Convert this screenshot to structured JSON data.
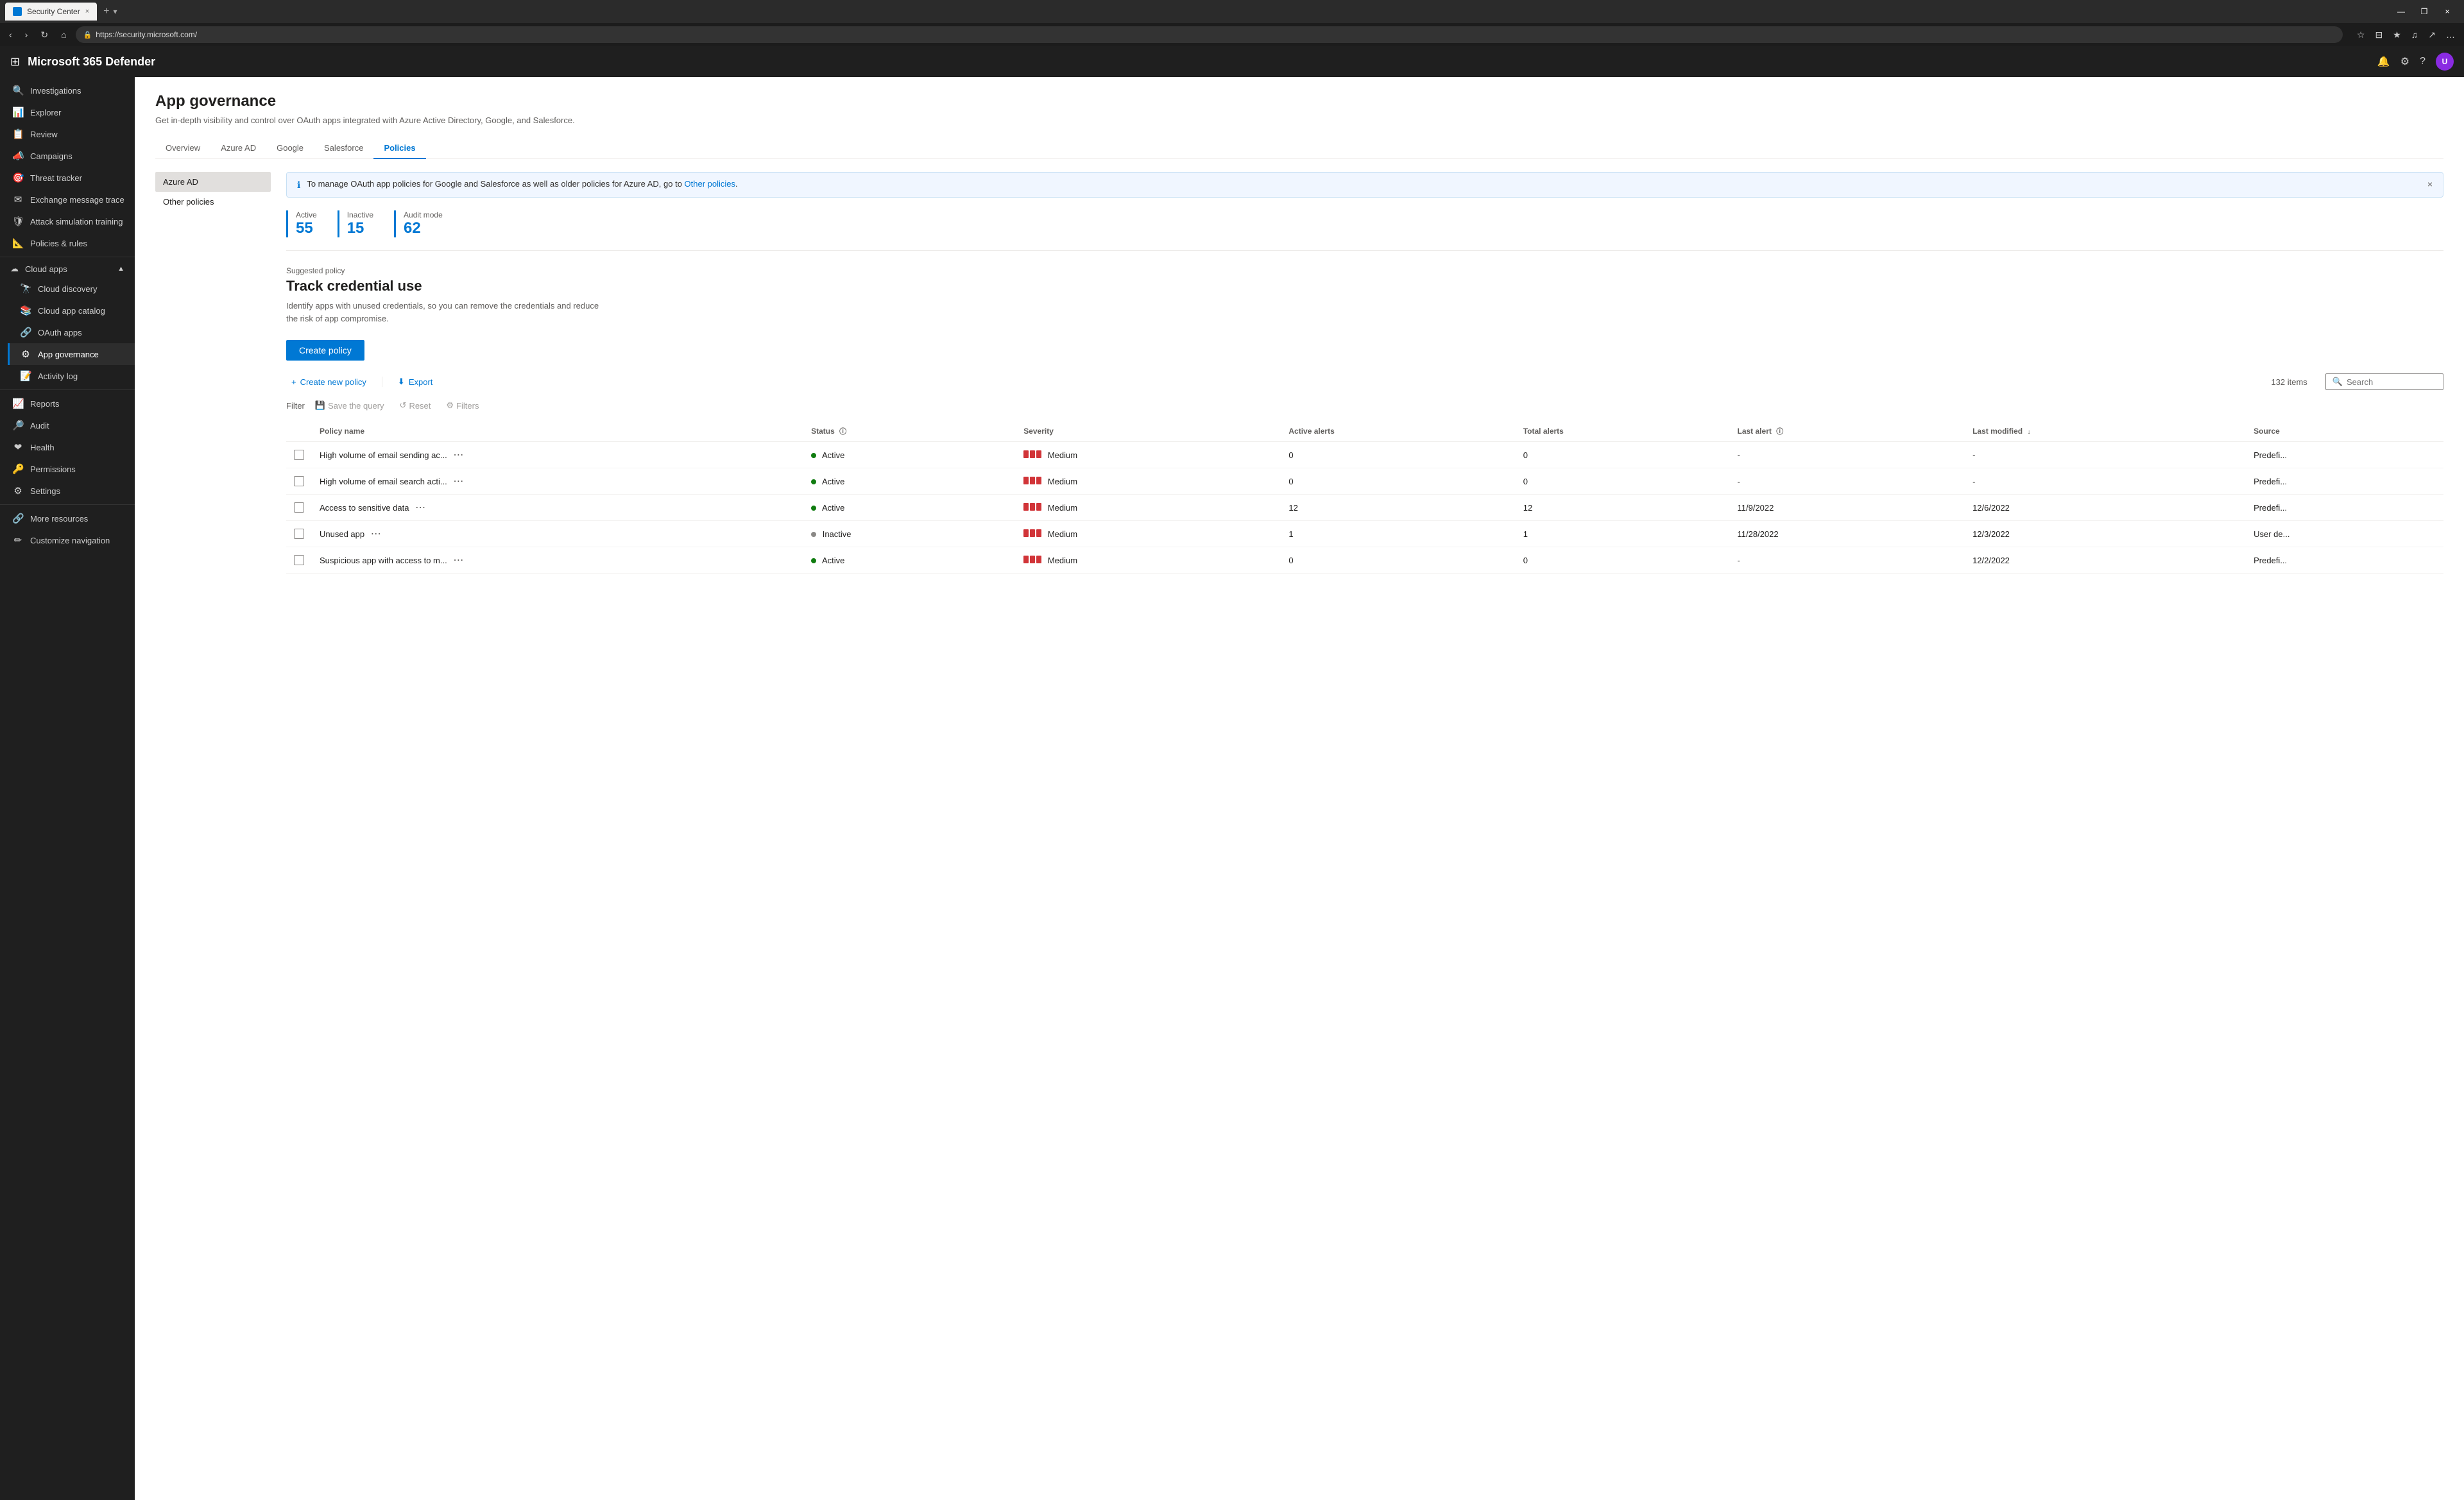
{
  "browser": {
    "tab_title": "Security Center",
    "url": "https://security.microsoft.com/",
    "tab_close": "×",
    "new_tab": "+",
    "win_minimize": "—",
    "win_restore": "❐",
    "win_close": "×"
  },
  "topbar": {
    "app_title": "Microsoft 365 Defender",
    "grid_icon": "⊞"
  },
  "sidebar": {
    "items": [
      {
        "id": "investigations",
        "label": "Investigations",
        "icon": "🔍"
      },
      {
        "id": "explorer",
        "label": "Explorer",
        "icon": "📊"
      },
      {
        "id": "review",
        "label": "Review",
        "icon": "📋"
      },
      {
        "id": "campaigns",
        "label": "Campaigns",
        "icon": "📣"
      },
      {
        "id": "threat-tracker",
        "label": "Threat tracker",
        "icon": "🎯"
      },
      {
        "id": "exchange",
        "label": "Exchange message trace",
        "icon": "✉"
      },
      {
        "id": "attack-sim",
        "label": "Attack simulation training",
        "icon": "🛡"
      },
      {
        "id": "policies",
        "label": "Policies & rules",
        "icon": "📐"
      },
      {
        "id": "cloud-apps-group",
        "label": "Cloud apps",
        "icon": "☁",
        "expandable": true,
        "expanded": true
      },
      {
        "id": "cloud-discovery",
        "label": "Cloud discovery",
        "icon": "🔭",
        "sub": true
      },
      {
        "id": "cloud-catalog",
        "label": "Cloud app catalog",
        "icon": "📚",
        "sub": true
      },
      {
        "id": "oauth-apps",
        "label": "OAuth apps",
        "icon": "🔗",
        "sub": true
      },
      {
        "id": "app-governance",
        "label": "App governance",
        "icon": "⚙",
        "sub": true,
        "active": true
      },
      {
        "id": "activity-log",
        "label": "Activity log",
        "icon": "📝",
        "sub": true
      },
      {
        "id": "reports",
        "label": "Reports",
        "icon": "📈"
      },
      {
        "id": "audit",
        "label": "Audit",
        "icon": "🔎"
      },
      {
        "id": "health",
        "label": "Health",
        "icon": "❤"
      },
      {
        "id": "permissions",
        "label": "Permissions",
        "icon": "🔑"
      },
      {
        "id": "settings",
        "label": "Settings",
        "icon": "⚙"
      },
      {
        "id": "more-resources",
        "label": "More resources",
        "icon": "🔗"
      },
      {
        "id": "customize-nav",
        "label": "Customize navigation",
        "icon": "✏"
      }
    ]
  },
  "page": {
    "title": "App governance",
    "description": "Get in-depth visibility and control over OAuth apps integrated with Azure Active Directory, Google, and Salesforce.",
    "tabs": [
      {
        "id": "overview",
        "label": "Overview",
        "active": false
      },
      {
        "id": "azure-ad",
        "label": "Azure AD",
        "active": false
      },
      {
        "id": "google",
        "label": "Google",
        "active": false
      },
      {
        "id": "salesforce",
        "label": "Salesforce",
        "active": false
      },
      {
        "id": "policies",
        "label": "Policies",
        "active": true
      }
    ]
  },
  "policy_nav": [
    {
      "id": "azure-ad",
      "label": "Azure AD",
      "active": true
    },
    {
      "id": "other-policies",
      "label": "Other policies",
      "active": false
    }
  ],
  "info_banner": {
    "text": "To manage OAuth app policies for Google and Salesforce as well as older policies for Azure AD, go to ",
    "link_text": "Other policies",
    "link": "#"
  },
  "stats": [
    {
      "label": "Active",
      "value": "55"
    },
    {
      "label": "Inactive",
      "value": "15"
    },
    {
      "label": "Audit mode",
      "value": "62"
    }
  ],
  "suggested_policy": {
    "section_label": "Suggested policy",
    "title": "Track credential use",
    "description": "Identify apps with unused credentials, so you can remove the credentials and reduce\nthe risk of app compromise."
  },
  "toolbar": {
    "create_policy_btn": "Create policy",
    "create_new_policy": "Create new policy",
    "export": "Export",
    "item_count": "132 items",
    "search_placeholder": "Search",
    "filter_label": "Filter",
    "save_query": "Save the query",
    "reset": "Reset",
    "filters": "Filters"
  },
  "table": {
    "columns": [
      {
        "id": "policy-name",
        "label": "Policy name"
      },
      {
        "id": "status",
        "label": "Status",
        "has_info": true
      },
      {
        "id": "severity",
        "label": "Severity"
      },
      {
        "id": "active-alerts",
        "label": "Active alerts"
      },
      {
        "id": "total-alerts",
        "label": "Total alerts"
      },
      {
        "id": "last-alert",
        "label": "Last alert",
        "has_info": true
      },
      {
        "id": "last-modified",
        "label": "Last modified",
        "sorted": true
      },
      {
        "id": "source",
        "label": "Source"
      }
    ],
    "rows": [
      {
        "policy_name": "High volume of email sending ac...",
        "status": "Active",
        "status_type": "active",
        "severity": "Medium",
        "active_alerts": "0",
        "total_alerts": "0",
        "last_alert": "-",
        "last_modified": "-",
        "source": "Predefi..."
      },
      {
        "policy_name": "High volume of email search acti...",
        "status": "Active",
        "status_type": "active",
        "severity": "Medium",
        "active_alerts": "0",
        "total_alerts": "0",
        "last_alert": "-",
        "last_modified": "-",
        "source": "Predefi..."
      },
      {
        "policy_name": "Access to sensitive data",
        "status": "Active",
        "status_type": "active",
        "severity": "Medium",
        "active_alerts": "12",
        "total_alerts": "12",
        "last_alert": "11/9/2022",
        "last_modified": "12/6/2022",
        "source": "Predefi..."
      },
      {
        "policy_name": "Unused app",
        "status": "Inactive",
        "status_type": "inactive",
        "severity": "Medium",
        "active_alerts": "1",
        "total_alerts": "1",
        "last_alert": "11/28/2022",
        "last_modified": "12/3/2022",
        "source": "User de..."
      },
      {
        "policy_name": "Suspicious app with access to m...",
        "status": "Active",
        "status_type": "active",
        "severity": "Medium",
        "active_alerts": "0",
        "total_alerts": "0",
        "last_alert": "-",
        "last_modified": "12/2/2022",
        "source": "Predefi..."
      }
    ]
  }
}
